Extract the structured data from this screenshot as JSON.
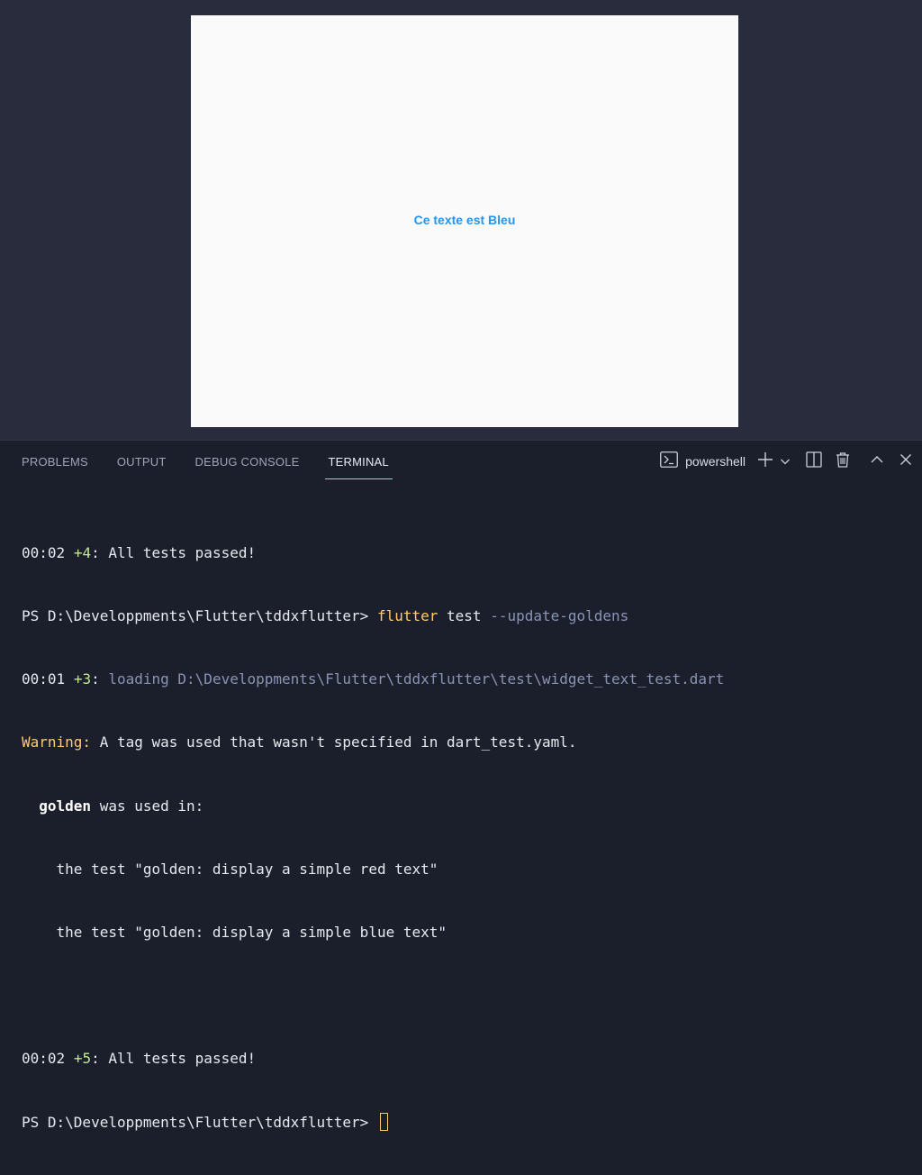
{
  "preview": {
    "text": "Ce texte est Bleu"
  },
  "panel": {
    "tabs": [
      {
        "label": "PROBLEMS"
      },
      {
        "label": "OUTPUT"
      },
      {
        "label": "DEBUG CONSOLE"
      },
      {
        "label": "TERMINAL",
        "active": true
      }
    ],
    "shell": "powershell"
  },
  "terminal": {
    "l1": {
      "time": "00:02",
      "count": "+4",
      "msg": ": All tests passed!"
    },
    "l2": {
      "prompt": "PS D:\\Developpments\\Flutter\\tddxflutter> ",
      "cmd": "flutter",
      "args": " test ",
      "flag": "--update-goldens"
    },
    "l3": {
      "time": "00:01",
      "count": "+3",
      "sep": ": ",
      "msg": "loading D:\\Developpments\\Flutter\\tddxflutter\\test\\widget_text_test.dart"
    },
    "l4": {
      "label": "Warning:",
      "msg": " A tag was used that wasn't specified in dart_test.yaml."
    },
    "l5": {
      "indent": "  ",
      "tag": "golden",
      "msg": " was used in:"
    },
    "l6": "    the test \"golden: display a simple red text\"",
    "l7": "    the test \"golden: display a simple blue text\"",
    "l9": {
      "time": "00:02",
      "count": "+5",
      "msg": ": All tests passed!"
    },
    "l10": {
      "prompt": "PS D:\\Developpments\\Flutter\\tddxflutter> "
    }
  },
  "colors": {
    "accent_green": "#c3e88d",
    "warning_yellow": "#ffcb6b",
    "preview_blue": "#2196f3",
    "tab_underline": "#8fd7c7"
  }
}
